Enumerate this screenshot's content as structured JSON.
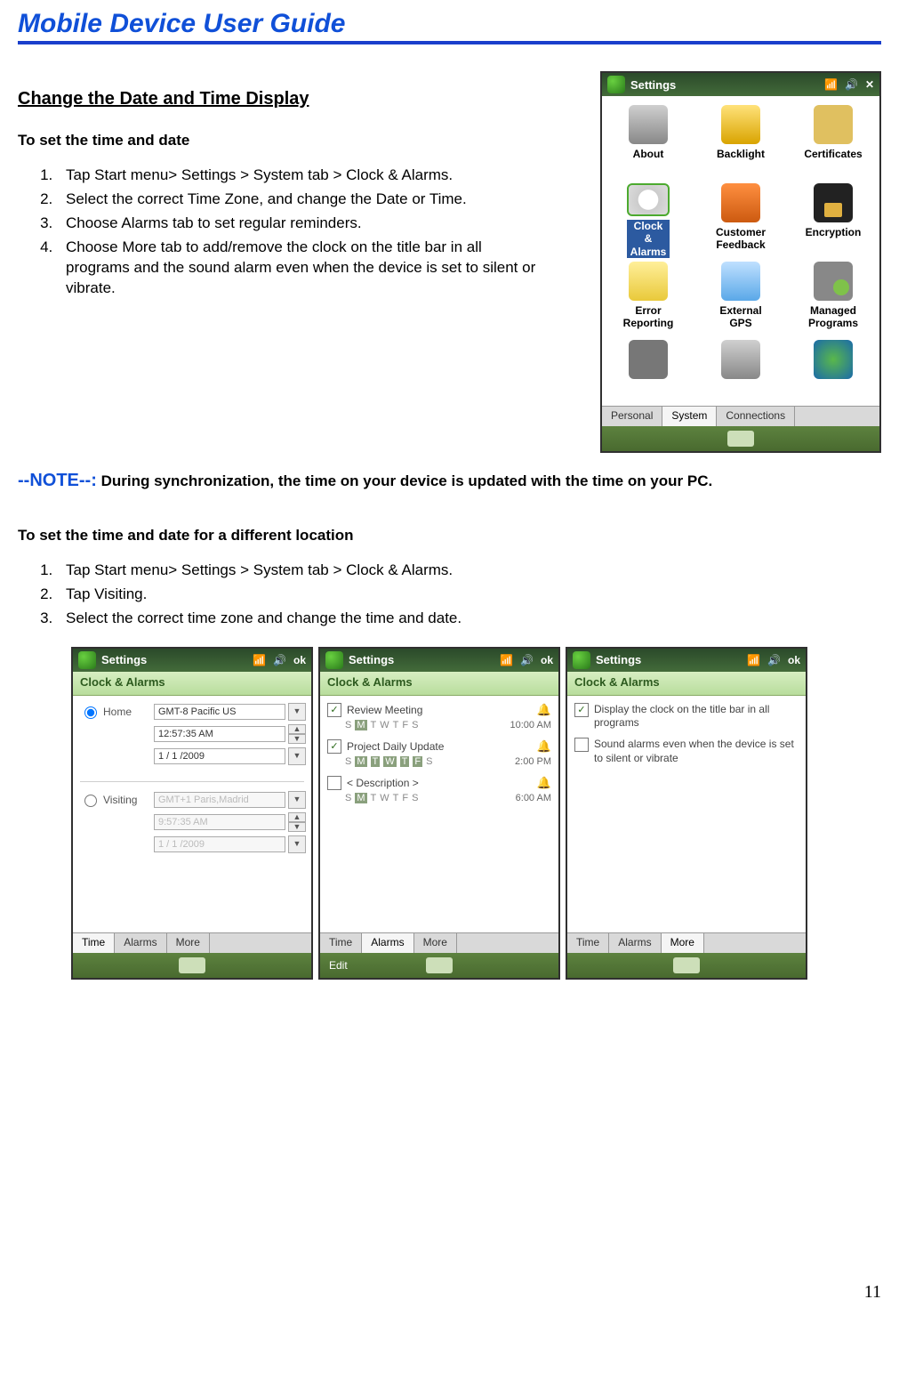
{
  "header": {
    "title": "Mobile Device User Guide"
  },
  "section1": {
    "title": "Change the Date and Time Display",
    "sub1": "To set the time and date",
    "steps1": [
      "Tap Start menu> Settings > System tab > Clock & Alarms.",
      "Select the correct Time Zone, and change the Date or Time.",
      "Choose Alarms tab to set regular reminders.",
      "Choose More tab to add/remove the clock on the title bar in all programs and the sound alarm even when the device is set to silent or vibrate."
    ]
  },
  "note": {
    "label": "--NOTE--:",
    "text": " During synchronization, the time on your device is updated with the time on your PC."
  },
  "section2": {
    "sub": "To set the time and date for a different location",
    "steps": [
      "Tap Start menu> Settings > System tab > Clock & Alarms.",
      "Tap Visiting.",
      "Select the correct time zone and change the time and date."
    ]
  },
  "page_number": "11",
  "settingsShot": {
    "title": "Settings",
    "tabs": [
      "Personal",
      "System",
      "Connections"
    ],
    "activeTab": "System",
    "items": [
      {
        "label": "About",
        "icon": "ic-about"
      },
      {
        "label": "Backlight",
        "icon": "ic-backlight"
      },
      {
        "label": "Certificates",
        "icon": "ic-cert"
      },
      {
        "label": "Clock & Alarms",
        "icon": "ic-clock",
        "selected": true
      },
      {
        "label": "Customer Feedback",
        "icon": "ic-feedback"
      },
      {
        "label": "Encryption",
        "icon": "ic-enc"
      },
      {
        "label": "Error Reporting",
        "icon": "ic-err"
      },
      {
        "label": "External GPS",
        "icon": "ic-gps"
      },
      {
        "label": "Managed Programs",
        "icon": "ic-man"
      },
      {
        "label": "",
        "icon": "ic-a"
      },
      {
        "label": "",
        "icon": "ic-b"
      },
      {
        "label": "",
        "icon": "ic-c"
      }
    ]
  },
  "shotTime": {
    "title": "Settings",
    "sub": "Clock & Alarms",
    "home": {
      "label": "Home",
      "tz": "GMT-8 Pacific US",
      "time": "12:57:35 AM",
      "date": "1 / 1 /2009"
    },
    "visiting": {
      "label": "Visiting",
      "tz": "GMT+1 Paris,Madrid",
      "time": "9:57:35 AM",
      "date": "1 / 1 /2009"
    },
    "tabs": [
      "Time",
      "Alarms",
      "More"
    ],
    "activeTab": "Time",
    "ok": "ok"
  },
  "shotAlarms": {
    "title": "Settings",
    "sub": "Clock & Alarms",
    "alarms": [
      {
        "checked": true,
        "name": "Review Meeting",
        "days": [
          "S",
          "M",
          "T",
          "W",
          "T",
          "F",
          "S"
        ],
        "onDays": [
          1
        ],
        "time": "10:00 AM"
      },
      {
        "checked": true,
        "name": "Project Daily Update",
        "days": [
          "S",
          "M",
          "T",
          "W",
          "T",
          "F",
          "S"
        ],
        "onDays": [
          1,
          2,
          3,
          4,
          5
        ],
        "time": "2:00 PM"
      },
      {
        "checked": false,
        "name": "< Description >",
        "days": [
          "S",
          "M",
          "T",
          "W",
          "T",
          "F",
          "S"
        ],
        "onDays": [
          1
        ],
        "time": "6:00 AM"
      }
    ],
    "tabs": [
      "Time",
      "Alarms",
      "More"
    ],
    "activeTab": "Alarms",
    "softLeft": "Edit",
    "ok": "ok"
  },
  "shotMore": {
    "title": "Settings",
    "sub": "Clock & Alarms",
    "opts": [
      {
        "checked": true,
        "text": "Display the clock on the title bar in all programs"
      },
      {
        "checked": false,
        "text": "Sound alarms even when the device is set to silent or vibrate"
      }
    ],
    "tabs": [
      "Time",
      "Alarms",
      "More"
    ],
    "activeTab": "More",
    "ok": "ok"
  }
}
